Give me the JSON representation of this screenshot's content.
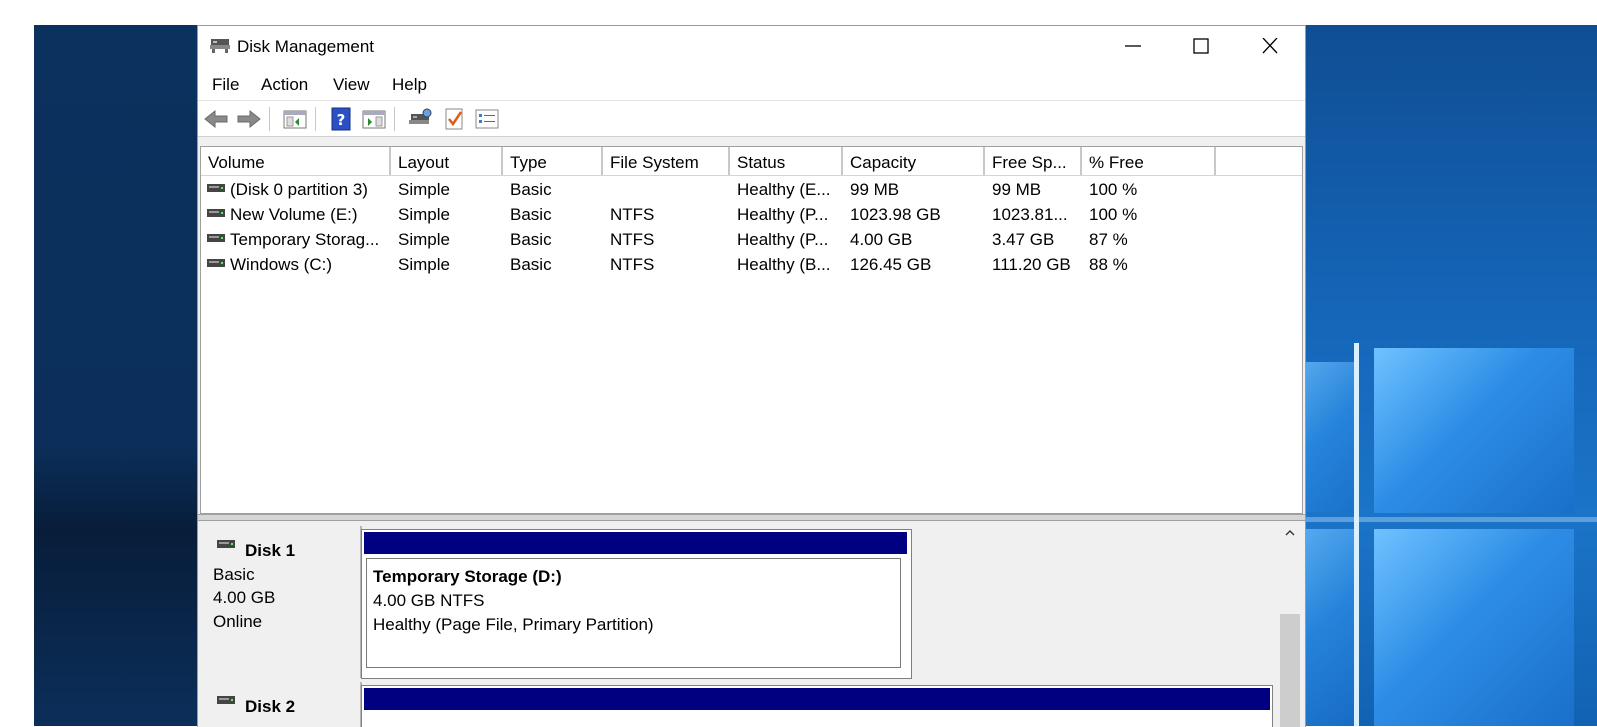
{
  "window": {
    "title": "Disk Management",
    "controls": {
      "minimize": "minimize",
      "maximize": "maximize",
      "close": "close"
    }
  },
  "menu": {
    "file": "File",
    "action": "Action",
    "view": "View",
    "help": "Help"
  },
  "toolbar": {
    "icons": [
      "back-icon",
      "forward-icon",
      "show-hide-console-tree-icon",
      "help-icon",
      "show-hide-action-pane-icon",
      "rescan-disks-icon",
      "properties-check-icon",
      "settings-list-icon"
    ]
  },
  "volume_list": {
    "columns": [
      "Volume",
      "Layout",
      "Type",
      "File System",
      "Status",
      "Capacity",
      "Free Sp...",
      "% Free"
    ],
    "rows": [
      {
        "volume": "(Disk 0 partition 3)",
        "layout": "Simple",
        "type": "Basic",
        "fs": "",
        "status": "Healthy (E...",
        "capacity": "99 MB",
        "free": "99 MB",
        "pct": "100 %"
      },
      {
        "volume": "New Volume (E:)",
        "layout": "Simple",
        "type": "Basic",
        "fs": "NTFS",
        "status": "Healthy (P...",
        "capacity": "1023.98 GB",
        "free": "1023.81...",
        "pct": "100 %"
      },
      {
        "volume": "Temporary Storag...",
        "layout": "Simple",
        "type": "Basic",
        "fs": "NTFS",
        "status": "Healthy (P...",
        "capacity": "4.00 GB",
        "free": "3.47 GB",
        "pct": "87 %"
      },
      {
        "volume": "Windows (C:)",
        "layout": "Simple",
        "type": "Basic",
        "fs": "NTFS",
        "status": "Healthy (B...",
        "capacity": "126.45 GB",
        "free": "111.20 GB",
        "pct": "88 %"
      }
    ]
  },
  "graphical": {
    "disk1": {
      "name": "Disk 1",
      "type": "Basic",
      "size": "4.00 GB",
      "state": "Online",
      "partition": {
        "title": "Temporary Storage  (D:)",
        "detail": "4.00 GB NTFS",
        "status": "Healthy (Page File, Primary Partition)"
      }
    },
    "disk2": {
      "name": "Disk 2"
    }
  },
  "colors": {
    "primary_partition_bar": "#000080",
    "desktop_blue": "#0c4f92"
  }
}
